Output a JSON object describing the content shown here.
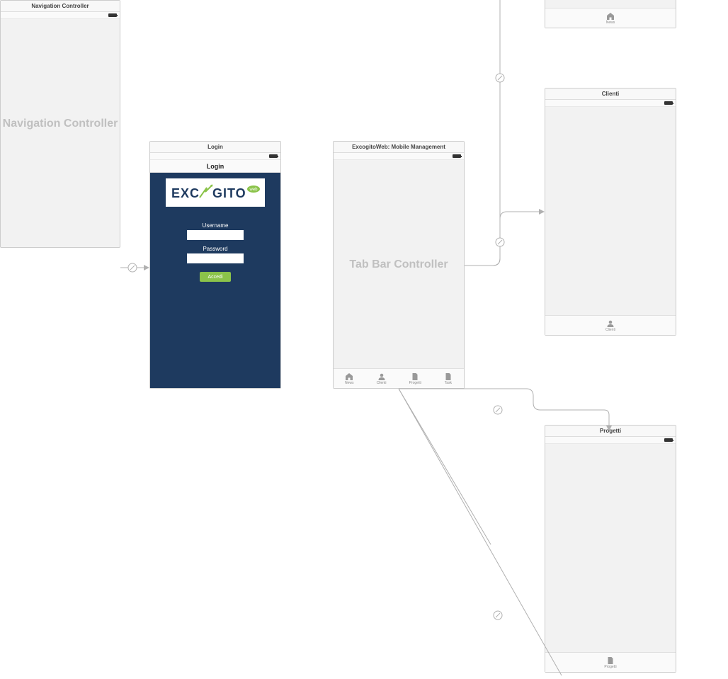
{
  "scenes": {
    "nav": {
      "title": "Navigation Controller",
      "placeholder": "Navigation Controller"
    },
    "login": {
      "title": "Login",
      "nav_title": "Login",
      "logo_text_a": "EXC",
      "logo_text_b": "GITO",
      "logo_badge": "web",
      "username_label": "Username",
      "password_label": "Password",
      "button_label": "Accedi"
    },
    "tabbar": {
      "title": "ExcogitoWeb: Mobile Management",
      "placeholder": "Tab Bar Controller",
      "tabs": [
        {
          "label": "News",
          "icon": "home"
        },
        {
          "label": "Clienti",
          "icon": "user"
        },
        {
          "label": "Progetti",
          "icon": "doc"
        },
        {
          "label": "Task",
          "icon": "doc"
        }
      ]
    },
    "home": {
      "tab_label": "News",
      "tab_icon": "home"
    },
    "clienti": {
      "title": "Clienti",
      "tab_label": "Clienti",
      "tab_icon": "user"
    },
    "progetti": {
      "title": "Progetti",
      "tab_label": "Progetti",
      "tab_icon": "doc"
    }
  }
}
